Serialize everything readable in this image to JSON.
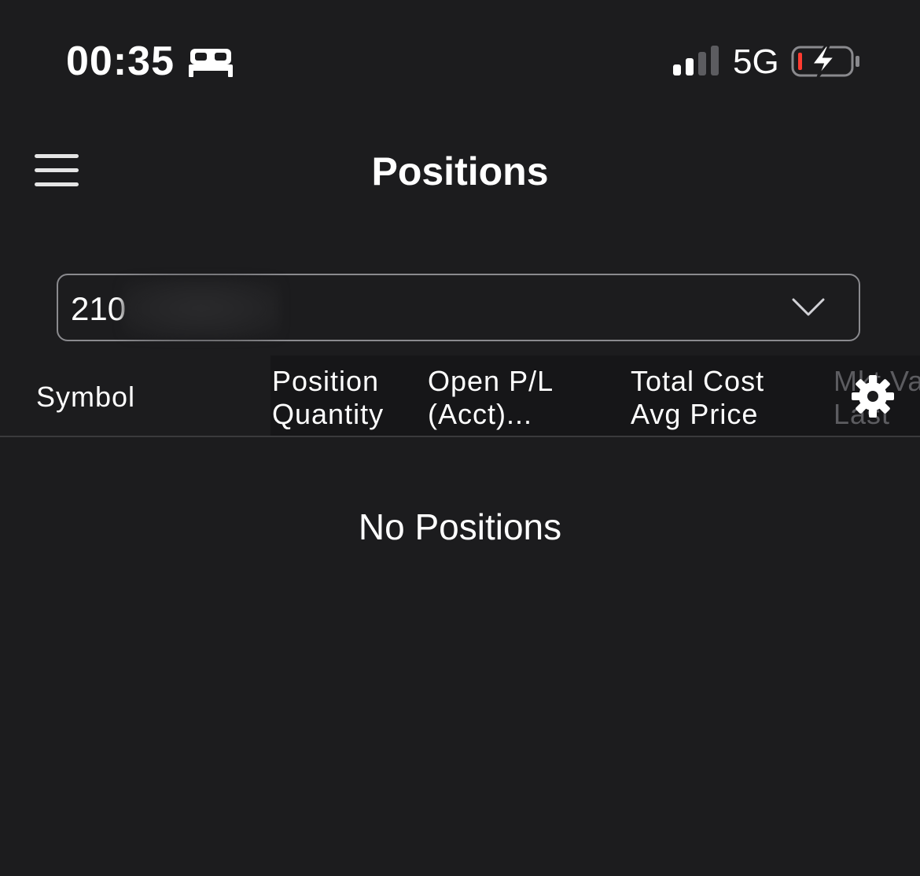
{
  "status_bar": {
    "time": "00:35",
    "network": "5G",
    "icons": [
      "bed-icon",
      "signal-icon",
      "battery-charging-icon"
    ]
  },
  "header": {
    "title": "Positions",
    "menu_icon": "hamburger-menu-icon"
  },
  "account_selector": {
    "value": "210",
    "icon": "chevron-down-icon"
  },
  "table": {
    "columns": [
      {
        "line1": "Symbol",
        "line2": ""
      },
      {
        "line1": "Position",
        "line2": "Quantity"
      },
      {
        "line1": "Open P/L",
        "line2": "(Acct)..."
      },
      {
        "line1": "Total Cost",
        "line2": "Avg Price"
      },
      {
        "line1": "Mkt Va",
        "line2": "Last"
      }
    ],
    "settings_icon": "gear-icon",
    "empty_message": "No Positions"
  },
  "colors": {
    "background": "#1c1c1e",
    "text": "#ffffff",
    "border": "#8a8a8e",
    "battery_low": "#ff3b30"
  }
}
